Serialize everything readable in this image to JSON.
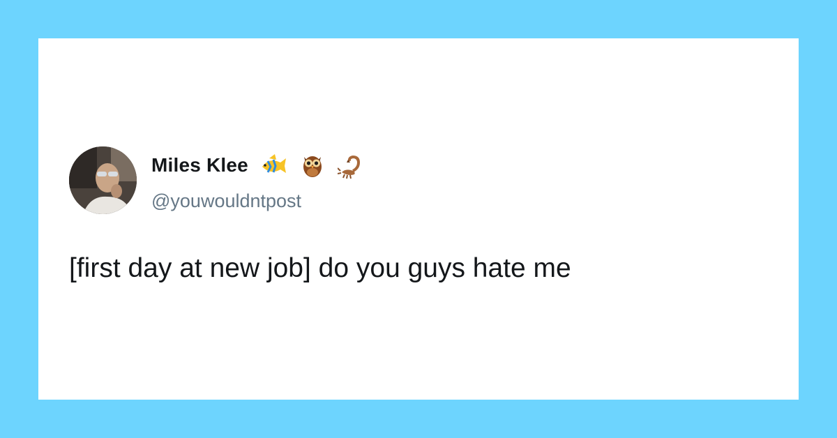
{
  "background_color": "#6dd4fe",
  "card_color": "#ffffff",
  "tweet": {
    "author_name": "Miles Klee",
    "handle": "@youwouldntpost",
    "name_emojis": [
      "tropical-fish-icon",
      "owl-icon",
      "scorpion-icon"
    ],
    "text": "[first day at new job] do you guys hate me"
  }
}
